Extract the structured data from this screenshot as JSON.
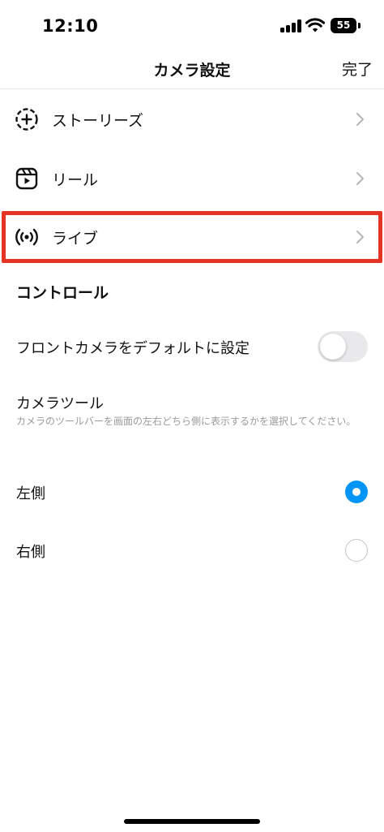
{
  "status_bar": {
    "time": "12:10",
    "battery": "55"
  },
  "nav": {
    "title": "カメラ設定",
    "done_label": "完了"
  },
  "menu": {
    "items": [
      {
        "label": "ストーリーズ",
        "icon": "story-add-icon"
      },
      {
        "label": "リール",
        "icon": "reels-icon"
      },
      {
        "label": "ライブ",
        "icon": "live-icon"
      }
    ]
  },
  "controls": {
    "section_title": "コントロール",
    "front_camera": {
      "label": "フロントカメラをデフォルトに設定",
      "enabled": false
    },
    "camera_tools": {
      "title": "カメラツール",
      "description": "カメラのツールバーを画面の左右どちら側に表示するかを選択してください。",
      "options": [
        {
          "label": "左側",
          "selected": true
        },
        {
          "label": "右側",
          "selected": false
        }
      ]
    }
  },
  "colors": {
    "accent": "#0095f6",
    "highlight": "#e53423"
  }
}
